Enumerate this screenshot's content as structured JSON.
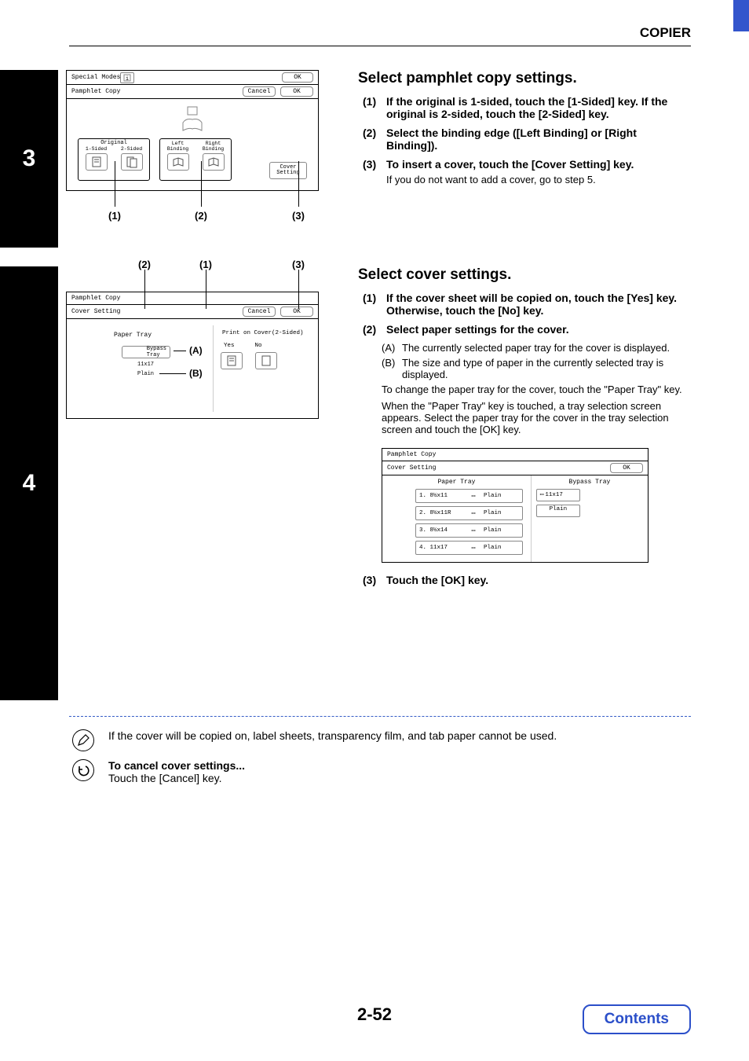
{
  "header": {
    "title": "COPIER"
  },
  "step3": {
    "num": "3",
    "panel": {
      "special_modes": "Special Modes",
      "ok1": "OK",
      "pamphlet_copy": "Pamphlet Copy",
      "cancel": "Cancel",
      "ok2": "OK",
      "original_label": "Original",
      "one_sided": "1-Sided",
      "two_sided": "2-Sided",
      "left_binding": "Left\nBinding",
      "right_binding": "Right\nBinding",
      "cover_setting": "Cover\nSetting"
    },
    "callouts": {
      "c1": "(1)",
      "c2": "(2)",
      "c3": "(3)"
    },
    "heading": "Select pamphlet copy settings.",
    "items": [
      {
        "num": "(1)",
        "bold": "If the original is 1-sided, touch the [1-Sided] key. If the original is 2-sided, touch the [2-Sided] key."
      },
      {
        "num": "(2)",
        "bold": "Select the binding edge ([Left Binding] or [Right Binding])."
      },
      {
        "num": "(3)",
        "bold": "To insert a cover, touch the [Cover Setting] key.",
        "note": "If you do not want to add a cover, go to step 5."
      }
    ]
  },
  "step4": {
    "num": "4",
    "toplabels": {
      "l1": "(1)",
      "l2": "(2)",
      "l3": "(3)"
    },
    "panel": {
      "pamphlet_copy": "Pamphlet Copy",
      "cover_setting": "Cover Setting",
      "cancel": "Cancel",
      "ok": "OK",
      "paper_tray": "Paper Tray",
      "bypass_tray": "Bypass\nTray",
      "a_label": "(A)",
      "size": "11x17",
      "plain": "Plain",
      "b_label": "(B)",
      "print_on_cover": "Print on Cover(2-Sided)",
      "yes": "Yes",
      "no": "No"
    },
    "heading": "Select cover settings.",
    "items": [
      {
        "num": "(1)",
        "bold": "If the cover sheet will be copied on, touch the [Yes] key. Otherwise, touch the [No] key."
      },
      {
        "num": "(2)",
        "bold": "Select paper settings for the cover."
      }
    ],
    "sub": {
      "a": "The currently selected paper tray for the cover is displayed.",
      "b": "The size and type of paper in the currently selected tray is displayed.",
      "change": "To change the paper tray for the cover, touch the \"Paper Tray\" key.",
      "when": "When the \"Paper Tray\" key is touched, a tray selection screen appears. Select the paper tray for the cover in the tray selection screen and touch the [OK] key."
    },
    "traypanel": {
      "pamphlet_copy": "Pamphlet Copy",
      "cover_setting": "Cover Setting",
      "ok": "OK",
      "left_head": "Paper Tray",
      "right_head": "Bypass Tray",
      "rows": [
        {
          "name": "1. 8½x11",
          "type": "Plain"
        },
        {
          "name": "2. 8½x11R",
          "type": "Plain"
        },
        {
          "name": "3. 8½x14",
          "type": "Plain"
        },
        {
          "name": "4. 11x17",
          "type": "Plain"
        }
      ],
      "bypass_size": "11x17",
      "bypass_type": "Plain"
    },
    "item3": {
      "num": "(3)",
      "bold": "Touch the [OK] key."
    }
  },
  "notes": {
    "n1": "If the cover will be copied on, label sheets, transparency film, and tab paper cannot be used.",
    "n2_bold": "To cancel cover settings...",
    "n2_body": "Touch the [Cancel] key."
  },
  "footer": {
    "page": "2-52",
    "contents": "Contents"
  }
}
